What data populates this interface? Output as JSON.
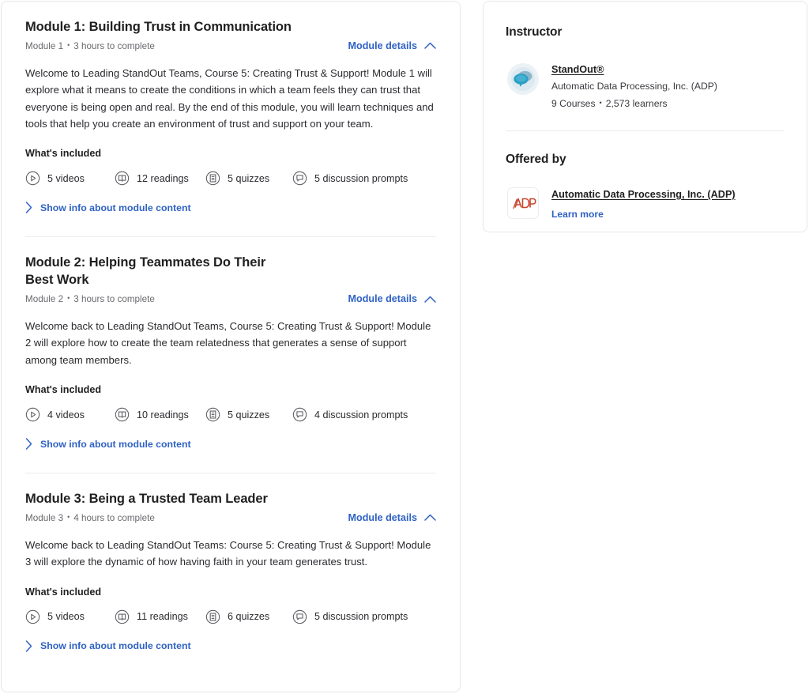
{
  "modules": [
    {
      "title": "Module 1: Building Trust in Communication",
      "meta_label": "Module 1",
      "meta_duration": "3 hours to complete",
      "details_label": "Module details",
      "description": "Welcome to Leading StandOut Teams, Course 5: Creating Trust & Support! Module 1 will explore what it means to create the conditions in which a team feels they can trust that everyone is being open and real. By the end of this module, you will learn techniques and tools that help you create an environment of trust and support on your team.",
      "included_heading": "What's included",
      "videos": "5 videos",
      "readings": "12 readings",
      "quizzes": "5 quizzes",
      "discussions": "5 discussion prompts",
      "show_info_label": "Show info about module content"
    },
    {
      "title": "Module 2: Helping Teammates Do Their Best Work",
      "meta_label": "Module 2",
      "meta_duration": "3 hours to complete",
      "details_label": "Module details",
      "description": "Welcome back to Leading StandOut Teams, Course 5: Creating Trust & Support! Module 2 will explore how to create the team relatedness that generates a sense of support among team members.",
      "included_heading": "What's included",
      "videos": "4 videos",
      "readings": "10 readings",
      "quizzes": "5 quizzes",
      "discussions": "4 discussion prompts",
      "show_info_label": "Show info about module content"
    },
    {
      "title": "Module 3: Being a Trusted Team Leader",
      "meta_label": "Module 3",
      "meta_duration": "4 hours to complete",
      "details_label": "Module details",
      "description": "Welcome back to Leading StandOut Teams: Course 5: Creating Trust & Support! Module 3 will explore the dynamic of how having faith in your team generates trust.",
      "included_heading": "What's included",
      "videos": "5 videos",
      "readings": "11 readings",
      "quizzes": "6 quizzes",
      "discussions": "5 discussion prompts",
      "show_info_label": "Show info about module content"
    }
  ],
  "sidebar": {
    "instructor_heading": "Instructor",
    "instructor": {
      "name": "StandOut®",
      "organization": "Automatic Data Processing, Inc. (ADP)",
      "courses": "9 Courses",
      "learners": "2,573 learners"
    },
    "offered_by_heading": "Offered by",
    "provider": {
      "name": "Automatic Data Processing, Inc. (ADP)",
      "learn_more_label": "Learn more",
      "logo_text": "ADP"
    }
  },
  "colors": {
    "link_blue": "#2f62c4",
    "text_primary": "#1f1f1f",
    "text_muted": "#6b6b70",
    "border": "#e5e7eb",
    "divider": "#ededef",
    "adp_red": "#c8432f"
  },
  "separator": "•"
}
